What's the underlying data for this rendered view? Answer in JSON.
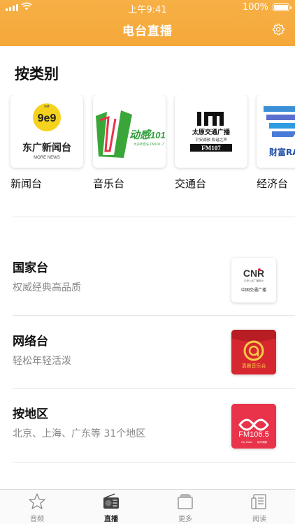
{
  "status": {
    "time": "上午9:41",
    "battery": "100%"
  },
  "header": {
    "title": "电台直播",
    "settings_icon": "gear-icon"
  },
  "category_section": {
    "title": "按类别",
    "items": [
      {
        "label": "新闻台",
        "logo_text": "东广新闻台",
        "logo_sub": "MORE NEWS",
        "logo_num": "90.9"
      },
      {
        "label": "音乐台",
        "logo_text": "动感101",
        "logo_sub": "大声听音乐 FM101.7",
        "logo_num": "101"
      },
      {
        "label": "交通台",
        "logo_text": "太原交通广播",
        "logo_sub": "平安调频 和谐之声",
        "logo_num": "FM107"
      },
      {
        "label": "经济台",
        "logo_text": "财富RA",
        "logo_sub": "",
        "logo_num": ""
      }
    ]
  },
  "rows": [
    {
      "title": "国家台",
      "subtitle": "权威经典高品质",
      "logo_text": "CNR",
      "logo_small": "中央人民广播电台",
      "logo_sub": "中国交通广播"
    },
    {
      "title": "网络台",
      "subtitle": "轻松年轻活泼",
      "logo_text": "清晨音乐台",
      "logo_small": "",
      "logo_sub": ""
    },
    {
      "title": "按地区",
      "subtitle": "北京、上海、广东等 31个地区",
      "logo_text": "FM106.5",
      "logo_small": "City Radio",
      "logo_sub": "城市调频"
    }
  ],
  "tabbar": {
    "tabs": [
      {
        "label": "音频",
        "icon": "star-icon"
      },
      {
        "label": "直播",
        "icon": "radio-icon"
      },
      {
        "label": "更多",
        "icon": "more-icon"
      },
      {
        "label": "阅读",
        "icon": "reading-icon"
      }
    ],
    "active": "直播"
  },
  "colors": {
    "header": "#F5A83A",
    "accent_red": "#E8334A",
    "green": "#2E9E3A"
  }
}
